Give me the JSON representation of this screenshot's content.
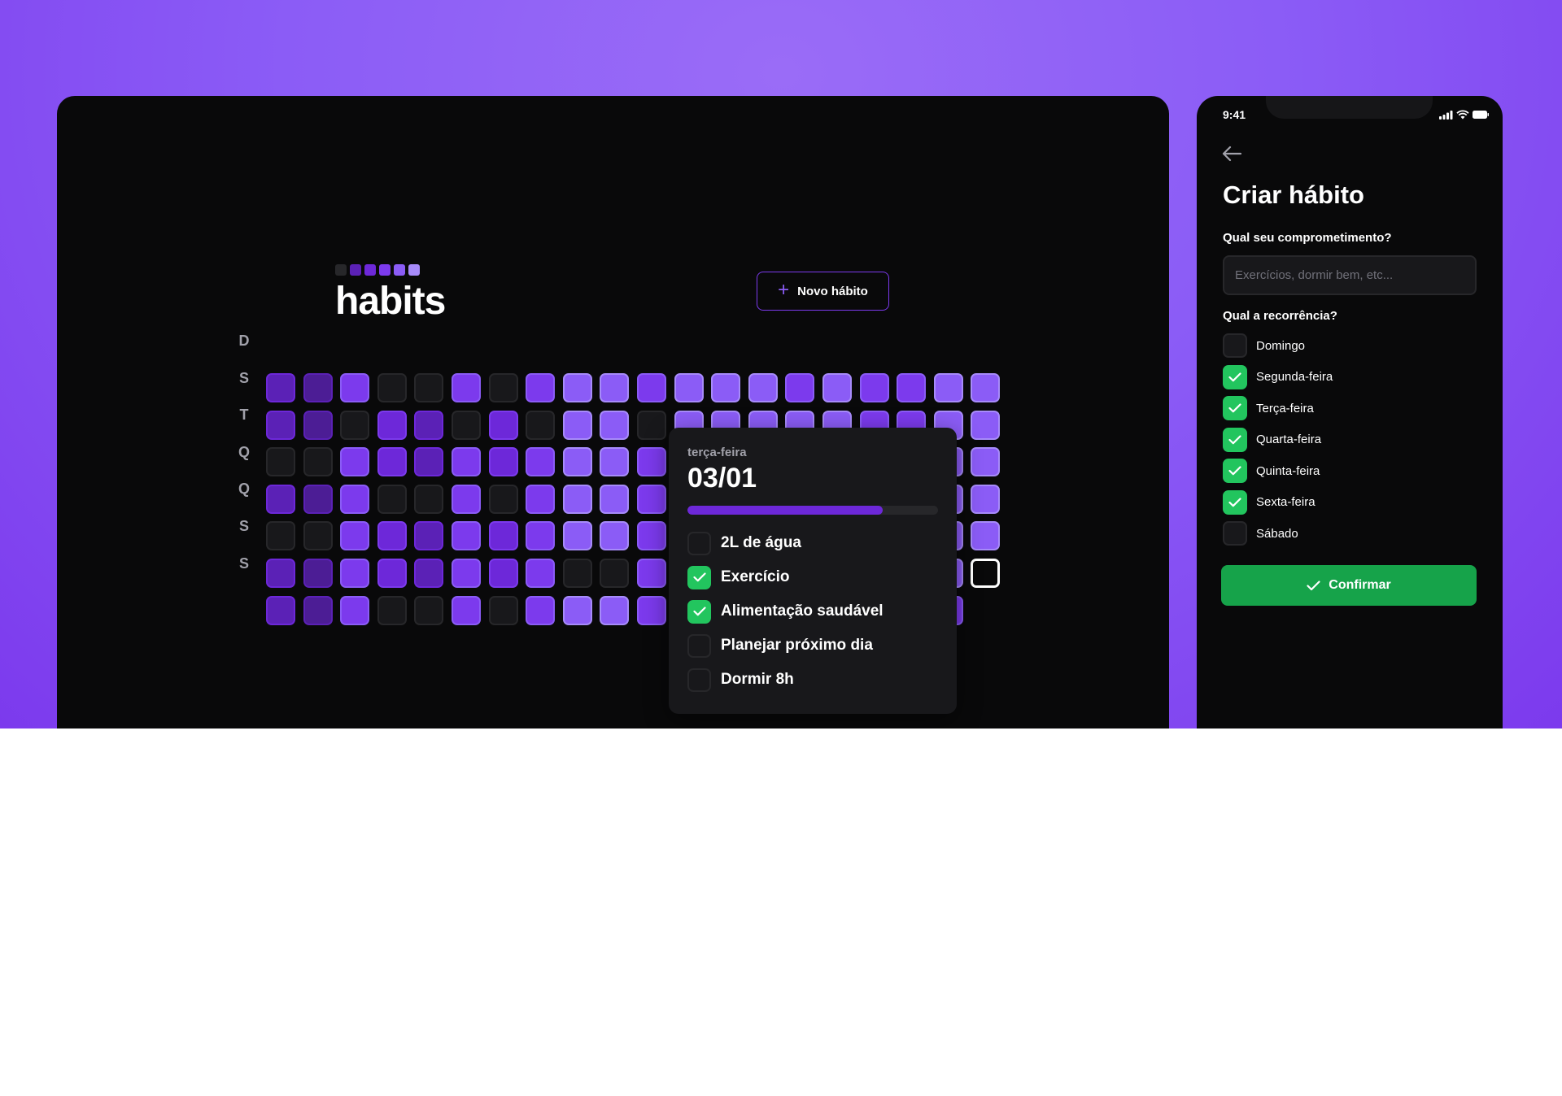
{
  "colors": {
    "background_accent": "#8b5cf6",
    "panel_bg": "#09090a",
    "violet_levels": [
      "#18181b",
      "#4c1d95",
      "#5b21b6",
      "#6d28d9",
      "#7c3aed",
      "#8b5cf6"
    ],
    "check_green": "#22c55e",
    "confirm_green": "#16a34a"
  },
  "desktop": {
    "logo_icon": "habits-logo-squares",
    "title": "habits",
    "new_habit_button": {
      "icon": "plus-icon",
      "label": "Novo hábito"
    },
    "weekdays": [
      "D",
      "S",
      "T",
      "Q",
      "Q",
      "S",
      "S"
    ],
    "heatmap_levels": [
      [
        2,
        1,
        4,
        0,
        0,
        4,
        0,
        4,
        5,
        5,
        4,
        5,
        5,
        5,
        4,
        5,
        4,
        4,
        5,
        5
      ],
      [
        2,
        1,
        0,
        3,
        2,
        0,
        3,
        0,
        5,
        5,
        0,
        5,
        5,
        5,
        5,
        5,
        4,
        4,
        5,
        5
      ],
      [
        0,
        0,
        4,
        3,
        2,
        4,
        3,
        4,
        5,
        5,
        4,
        5,
        5,
        5,
        5,
        5,
        5,
        4,
        5,
        5
      ],
      [
        2,
        1,
        4,
        0,
        0,
        4,
        0,
        4,
        5,
        5,
        4,
        5,
        5,
        5,
        4,
        5,
        4,
        4,
        5,
        5
      ],
      [
        0,
        0,
        4,
        3,
        2,
        4,
        3,
        4,
        5,
        5,
        4,
        5,
        5,
        5,
        5,
        5,
        5,
        4,
        5,
        5
      ],
      [
        2,
        1,
        4,
        3,
        2,
        4,
        3,
        4,
        0,
        0,
        4,
        5,
        5,
        5,
        5,
        5,
        5,
        4,
        5,
        -1
      ],
      [
        2,
        1,
        4,
        0,
        0,
        4,
        0,
        4,
        5,
        5,
        4,
        5,
        5,
        5,
        4,
        5,
        4,
        4,
        4,
        null
      ]
    ],
    "popover": {
      "weekday": "terça-feira",
      "date": "03/01",
      "progress": 0.78,
      "habits": [
        {
          "label": "2L de água",
          "checked": false
        },
        {
          "label": "Exercício",
          "checked": true
        },
        {
          "label": "Alimentação saudável",
          "checked": true
        },
        {
          "label": "Planejar próximo dia",
          "checked": false
        },
        {
          "label": "Dormir 8h",
          "checked": false
        }
      ]
    }
  },
  "mobile": {
    "status_time": "9:41",
    "status_icons": [
      "signal-icon",
      "wifi-icon",
      "battery-icon"
    ],
    "back_icon": "arrow-left-icon",
    "title": "Criar hábito",
    "commitment_label": "Qual seu comprometimento?",
    "commitment_placeholder": "Exercícios, dormir bem, etc...",
    "recurrence_label": "Qual a recorrência?",
    "days": [
      {
        "label": "Domingo",
        "checked": false
      },
      {
        "label": "Segunda-feira",
        "checked": true
      },
      {
        "label": "Terça-feira",
        "checked": true
      },
      {
        "label": "Quarta-feira",
        "checked": true
      },
      {
        "label": "Quinta-feira",
        "checked": true
      },
      {
        "label": "Sexta-feira",
        "checked": true
      },
      {
        "label": "Sábado",
        "checked": false
      }
    ],
    "confirm_button": {
      "icon": "check-icon",
      "label": "Confirmar"
    }
  }
}
